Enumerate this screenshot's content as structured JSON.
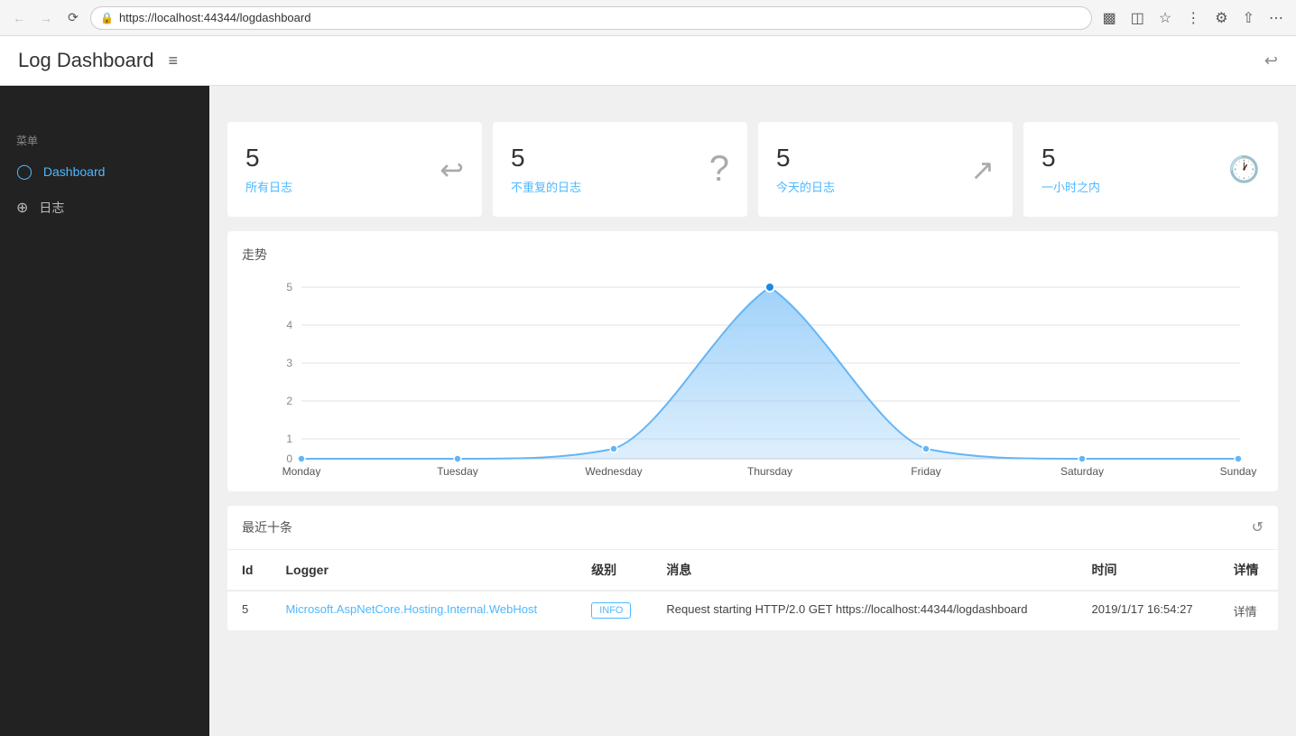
{
  "browser": {
    "url": "https://localhost:44344/logdashboard",
    "nav": {
      "back": "←",
      "forward": "→",
      "refresh": "↺"
    }
  },
  "page": {
    "title": "Log Dashboard",
    "menu_toggle": "≡",
    "back_icon": "↩"
  },
  "sidebar": {
    "section_label": "菜单",
    "items": [
      {
        "id": "dashboard",
        "label": "Dashboard",
        "icon": "⟳",
        "active": true
      },
      {
        "id": "logs",
        "label": "日志",
        "icon": "⊕",
        "active": false
      }
    ]
  },
  "stats": [
    {
      "id": "all-logs",
      "number": "5",
      "label": "所有日志",
      "icon": "↩"
    },
    {
      "id": "unique-logs",
      "number": "5",
      "label": "不重复的日志",
      "icon": "?"
    },
    {
      "id": "today-logs",
      "number": "5",
      "label": "今天的日志",
      "icon": "↗"
    },
    {
      "id": "hour-logs",
      "number": "5",
      "label": "一小时之内",
      "icon": "🕐"
    }
  ],
  "chart": {
    "title": "走势",
    "days": [
      "Monday",
      "Tuesday",
      "Wednesday",
      "Thursday",
      "Friday",
      "Saturday",
      "Sunday"
    ],
    "values": [
      0,
      0,
      0.3,
      5,
      0.3,
      0,
      0
    ],
    "y_labels": [
      "0",
      "1",
      "2",
      "3",
      "4",
      "5"
    ],
    "color": "#90caf9"
  },
  "recent_table": {
    "title": "最近十条",
    "refresh_icon": "↺",
    "columns": [
      {
        "key": "id",
        "label": "Id"
      },
      {
        "key": "logger",
        "label": "Logger"
      },
      {
        "key": "level",
        "label": "级别"
      },
      {
        "key": "message",
        "label": "消息"
      },
      {
        "key": "time",
        "label": "时间"
      },
      {
        "key": "detail",
        "label": "详情"
      }
    ],
    "rows": [
      {
        "id": "5",
        "logger": "Microsoft.AspNetCore.Hosting.Internal.WebHost",
        "level": "INFO",
        "message": "Request starting HTTP/2.0 GET https://localhost:44344/logdashboard",
        "time": "2019/1/17 16:54:27",
        "detail": "详情"
      }
    ]
  }
}
